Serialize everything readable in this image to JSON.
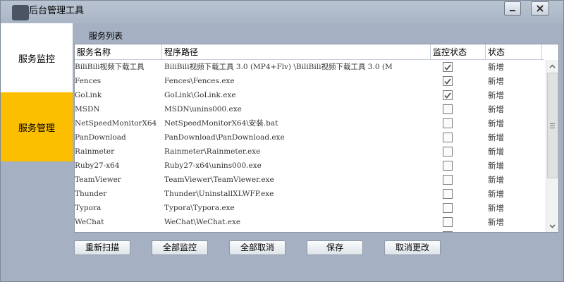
{
  "window": {
    "title": "后台管理工具",
    "minimize_icon": "minimize-icon",
    "close_icon": "close-icon"
  },
  "nav": {
    "items": [
      {
        "label": "服务监控",
        "active": false
      },
      {
        "label": "服务管理",
        "active": true
      }
    ],
    "active_color": "#fbbf00"
  },
  "services": {
    "section_label": "服务列表",
    "columns": [
      "服务名称",
      "程序路径",
      "监控状态",
      "状态"
    ],
    "rows": [
      {
        "name": "BiliBili视频下载工具",
        "path": "BiliBili视频下载工具 3.0 (MP4+Flv) \\BiliBili视频下载工具 3.0 (M",
        "monitored": true,
        "status": "新增"
      },
      {
        "name": "Fences",
        "path": "Fences\\Fences.exe",
        "monitored": true,
        "status": "新增"
      },
      {
        "name": "GoLink",
        "path": "GoLink\\GoLink.exe",
        "monitored": true,
        "status": "新增"
      },
      {
        "name": "MSDN",
        "path": "MSDN\\unins000.exe",
        "monitored": false,
        "status": "新增"
      },
      {
        "name": "NetSpeedMonitorX64",
        "path": "NetSpeedMonitorX64\\安装.bat",
        "monitored": false,
        "status": "新增"
      },
      {
        "name": "PanDownload",
        "path": "PanDownload\\PanDownload.exe",
        "monitored": false,
        "status": "新增"
      },
      {
        "name": "Rainmeter",
        "path": "Rainmeter\\Rainmeter.exe",
        "monitored": false,
        "status": "新增"
      },
      {
        "name": "Ruby27-x64",
        "path": "Ruby27-x64\\unins000.exe",
        "monitored": false,
        "status": "新增"
      },
      {
        "name": "TeamViewer",
        "path": "TeamViewer\\TeamViewer.exe",
        "monitored": false,
        "status": "新增"
      },
      {
        "name": "Thunder",
        "path": "Thunder\\UninstallXLWFP.exe",
        "monitored": false,
        "status": "新增"
      },
      {
        "name": "Typora",
        "path": "Typora\\Typora.exe",
        "monitored": false,
        "status": "新增"
      },
      {
        "name": "WeChat",
        "path": "WeChat\\WeChat.exe",
        "monitored": false,
        "status": "新增"
      },
      {
        "name": "",
        "path": "",
        "monitored": false,
        "status": "新增"
      }
    ]
  },
  "actions": {
    "rescan": "重新扫描",
    "monitor_all": "全部监控",
    "cancel_all": "全部取消",
    "save": "保存",
    "cancel_changes": "取消更改"
  }
}
